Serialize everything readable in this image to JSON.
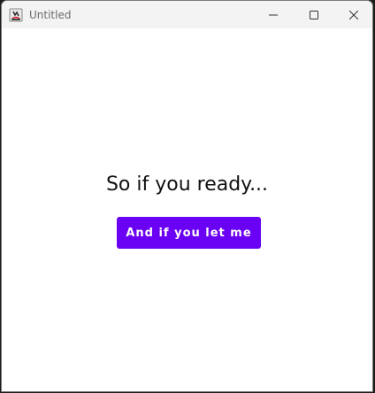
{
  "window": {
    "title": "Untitled",
    "icon": "java-app-icon",
    "controls": {
      "minimize_icon": "minimize-icon",
      "maximize_icon": "maximize-icon",
      "close_icon": "close-icon"
    }
  },
  "content": {
    "heading": "So if you ready...",
    "button_label": "And if you let me"
  },
  "colors": {
    "accent": "#6a00f4",
    "titlebar": "#f3f3f3",
    "background": "#ffffff"
  }
}
